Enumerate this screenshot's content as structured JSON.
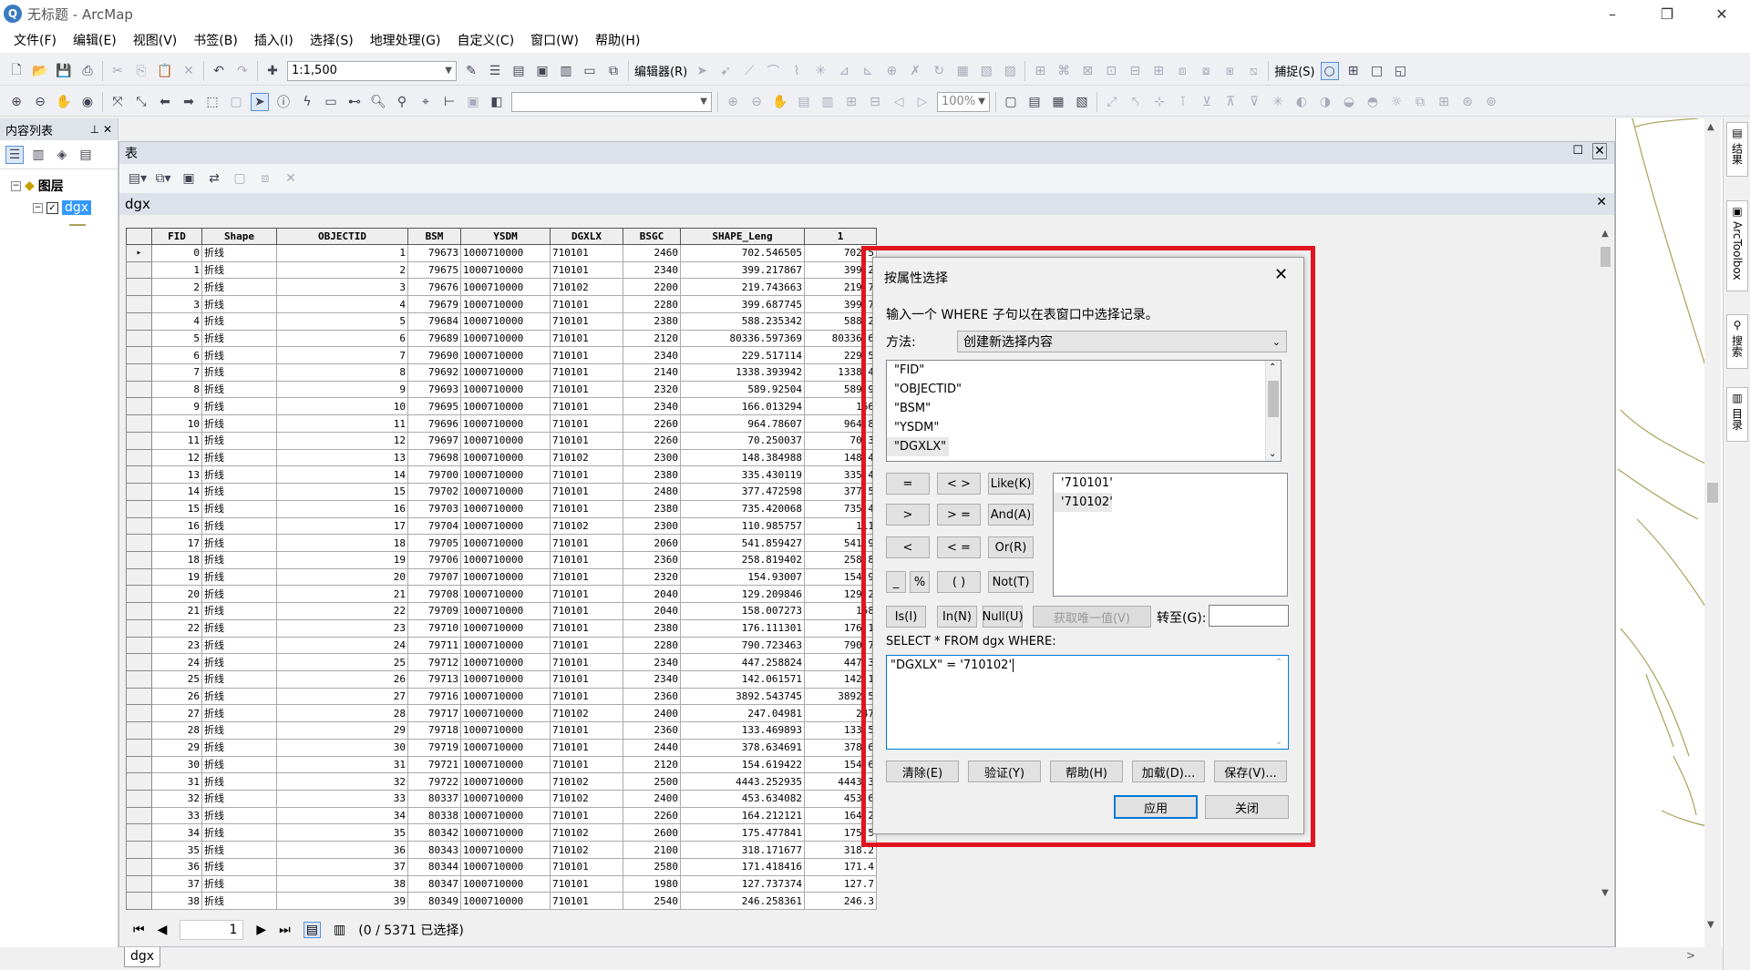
{
  "window": {
    "title": "无标题 - ArcMap",
    "logo": "Q"
  },
  "menu": [
    "文件(F)",
    "编辑(E)",
    "视图(V)",
    "书签(B)",
    "插入(I)",
    "选择(S)",
    "地理处理(G)",
    "自定义(C)",
    "窗口(W)",
    "帮助(H)"
  ],
  "toolbar": {
    "scale": "1:1,500",
    "editor": "编辑器(R)",
    "snapping": "捕捉(S)",
    "zoom": "100%"
  },
  "toc": {
    "title": "内容列表",
    "root_label": "图层",
    "layer_label": "dgx"
  },
  "table_window": {
    "title": "表",
    "layer": "dgx",
    "tab_label": "dgx"
  },
  "table": {
    "columns": [
      "FID",
      "Shape",
      "OBJECTID",
      "BSM",
      "YSDM",
      "DGXLX",
      "BSGC",
      "SHAPE_Leng",
      "1"
    ],
    "rows": [
      [
        "0",
        "折线",
        "1",
        "79673",
        "1000710000",
        "710101",
        "2460",
        "702.546505",
        "702.5"
      ],
      [
        "1",
        "折线",
        "2",
        "79675",
        "1000710000",
        "710101",
        "2340",
        "399.217867",
        "399.2"
      ],
      [
        "2",
        "折线",
        "3",
        "79676",
        "1000710000",
        "710102",
        "2200",
        "219.743663",
        "219.7"
      ],
      [
        "3",
        "折线",
        "4",
        "79679",
        "1000710000",
        "710101",
        "2280",
        "399.687745",
        "399.7"
      ],
      [
        "4",
        "折线",
        "5",
        "79684",
        "1000710000",
        "710101",
        "2380",
        "588.235342",
        "588.2"
      ],
      [
        "5",
        "折线",
        "6",
        "79689",
        "1000710000",
        "710101",
        "2120",
        "80336.597369",
        "80336.6"
      ],
      [
        "6",
        "折线",
        "7",
        "79690",
        "1000710000",
        "710101",
        "2340",
        "229.517114",
        "229.5"
      ],
      [
        "7",
        "折线",
        "8",
        "79692",
        "1000710000",
        "710101",
        "2140",
        "1338.393942",
        "1338.4"
      ],
      [
        "8",
        "折线",
        "9",
        "79693",
        "1000710000",
        "710101",
        "2320",
        "589.92504",
        "589.9"
      ],
      [
        "9",
        "折线",
        "10",
        "79695",
        "1000710000",
        "710101",
        "2340",
        "166.013294",
        "166"
      ],
      [
        "10",
        "折线",
        "11",
        "79696",
        "1000710000",
        "710101",
        "2260",
        "964.78607",
        "964.8"
      ],
      [
        "11",
        "折线",
        "12",
        "79697",
        "1000710000",
        "710101",
        "2260",
        "70.250037",
        "70.3"
      ],
      [
        "12",
        "折线",
        "13",
        "79698",
        "1000710000",
        "710102",
        "2300",
        "148.384988",
        "148.4"
      ],
      [
        "13",
        "折线",
        "14",
        "79700",
        "1000710000",
        "710101",
        "2380",
        "335.430119",
        "335.4"
      ],
      [
        "14",
        "折线",
        "15",
        "79702",
        "1000710000",
        "710101",
        "2480",
        "377.472598",
        "377.5"
      ],
      [
        "15",
        "折线",
        "16",
        "79703",
        "1000710000",
        "710101",
        "2380",
        "735.420068",
        "735.4"
      ],
      [
        "16",
        "折线",
        "17",
        "79704",
        "1000710000",
        "710102",
        "2300",
        "110.985757",
        "111"
      ],
      [
        "17",
        "折线",
        "18",
        "79705",
        "1000710000",
        "710101",
        "2060",
        "541.859427",
        "541.9"
      ],
      [
        "18",
        "折线",
        "19",
        "79706",
        "1000710000",
        "710101",
        "2360",
        "258.819402",
        "258.8"
      ],
      [
        "19",
        "折线",
        "20",
        "79707",
        "1000710000",
        "710101",
        "2320",
        "154.93007",
        "154.9"
      ],
      [
        "20",
        "折线",
        "21",
        "79708",
        "1000710000",
        "710101",
        "2040",
        "129.209846",
        "129.2"
      ],
      [
        "21",
        "折线",
        "22",
        "79709",
        "1000710000",
        "710101",
        "2040",
        "158.007273",
        "158"
      ],
      [
        "22",
        "折线",
        "23",
        "79710",
        "1000710000",
        "710101",
        "2380",
        "176.111301",
        "176.1"
      ],
      [
        "23",
        "折线",
        "24",
        "79711",
        "1000710000",
        "710101",
        "2280",
        "790.723463",
        "790.7"
      ],
      [
        "24",
        "折线",
        "25",
        "79712",
        "1000710000",
        "710101",
        "2340",
        "447.258824",
        "447.3"
      ],
      [
        "25",
        "折线",
        "26",
        "79713",
        "1000710000",
        "710101",
        "2340",
        "142.061571",
        "142.1"
      ],
      [
        "26",
        "折线",
        "27",
        "79716",
        "1000710000",
        "710101",
        "2360",
        "3892.543745",
        "3892.5"
      ],
      [
        "27",
        "折线",
        "28",
        "79717",
        "1000710000",
        "710102",
        "2400",
        "247.04981",
        "247"
      ],
      [
        "28",
        "折线",
        "29",
        "79718",
        "1000710000",
        "710101",
        "2360",
        "133.469893",
        "133.5"
      ],
      [
        "29",
        "折线",
        "30",
        "79719",
        "1000710000",
        "710101",
        "2440",
        "378.634691",
        "378.6"
      ],
      [
        "30",
        "折线",
        "31",
        "79721",
        "1000710000",
        "710101",
        "2120",
        "154.619422",
        "154.6"
      ],
      [
        "31",
        "折线",
        "32",
        "79722",
        "1000710000",
        "710102",
        "2500",
        "4443.252935",
        "4443.3"
      ],
      [
        "32",
        "折线",
        "33",
        "80337",
        "1000710000",
        "710102",
        "2400",
        "453.634082",
        "453.6"
      ],
      [
        "33",
        "折线",
        "34",
        "80338",
        "1000710000",
        "710101",
        "2260",
        "164.212121",
        "164.2"
      ],
      [
        "34",
        "折线",
        "35",
        "80342",
        "1000710000",
        "710102",
        "2600",
        "175.477841",
        "175.5"
      ],
      [
        "35",
        "折线",
        "36",
        "80343",
        "1000710000",
        "710102",
        "2100",
        "318.171677",
        "318.2"
      ],
      [
        "36",
        "折线",
        "37",
        "80344",
        "1000710000",
        "710101",
        "2580",
        "171.418416",
        "171.4"
      ],
      [
        "37",
        "折线",
        "38",
        "80347",
        "1000710000",
        "710101",
        "1980",
        "127.737374",
        "127.7"
      ],
      [
        "38",
        "折线",
        "39",
        "80349",
        "1000710000",
        "710101",
        "2540",
        "246.258361",
        "246.3"
      ]
    ]
  },
  "nav": {
    "page": "1",
    "status": "(0 / 5371 已选择)"
  },
  "dialog": {
    "title": "按属性选择",
    "instruction": "输入一个 WHERE 子句以在表窗口中选择记录。",
    "method_label": "方法:",
    "method_value": "创建新选择内容",
    "fields": [
      "\"FID\"",
      "\"OBJECTID\"",
      "\"BSM\"",
      "\"YSDM\"",
      "\"DGXLX\""
    ],
    "values": [
      "'710101'",
      "'710102'"
    ],
    "ops": [
      "=",
      "< >",
      "Like(K)",
      ">",
      "> =",
      "And(A)",
      "<",
      "< =",
      "Or(R)",
      "_",
      "%",
      "( )",
      "Not(T)"
    ],
    "btn_is": "Is(I)",
    "btn_in": "In(N)",
    "btn_null": "Null(U)",
    "btn_unique": "获取唯一值(V)",
    "goto_label": "转至(G):",
    "select_label": "SELECT * FROM dgx WHERE:",
    "expression": "\"DGXLX\" = '710102'",
    "btn_clear": "清除(E)",
    "btn_verify": "验证(Y)",
    "btn_help": "帮助(H)",
    "btn_load": "加载(D)...",
    "btn_save": "保存(V)...",
    "btn_apply": "应用",
    "btn_close": "关闭"
  },
  "right_dock": [
    "结果",
    "ArcToolbox",
    "搜索",
    "目录"
  ]
}
